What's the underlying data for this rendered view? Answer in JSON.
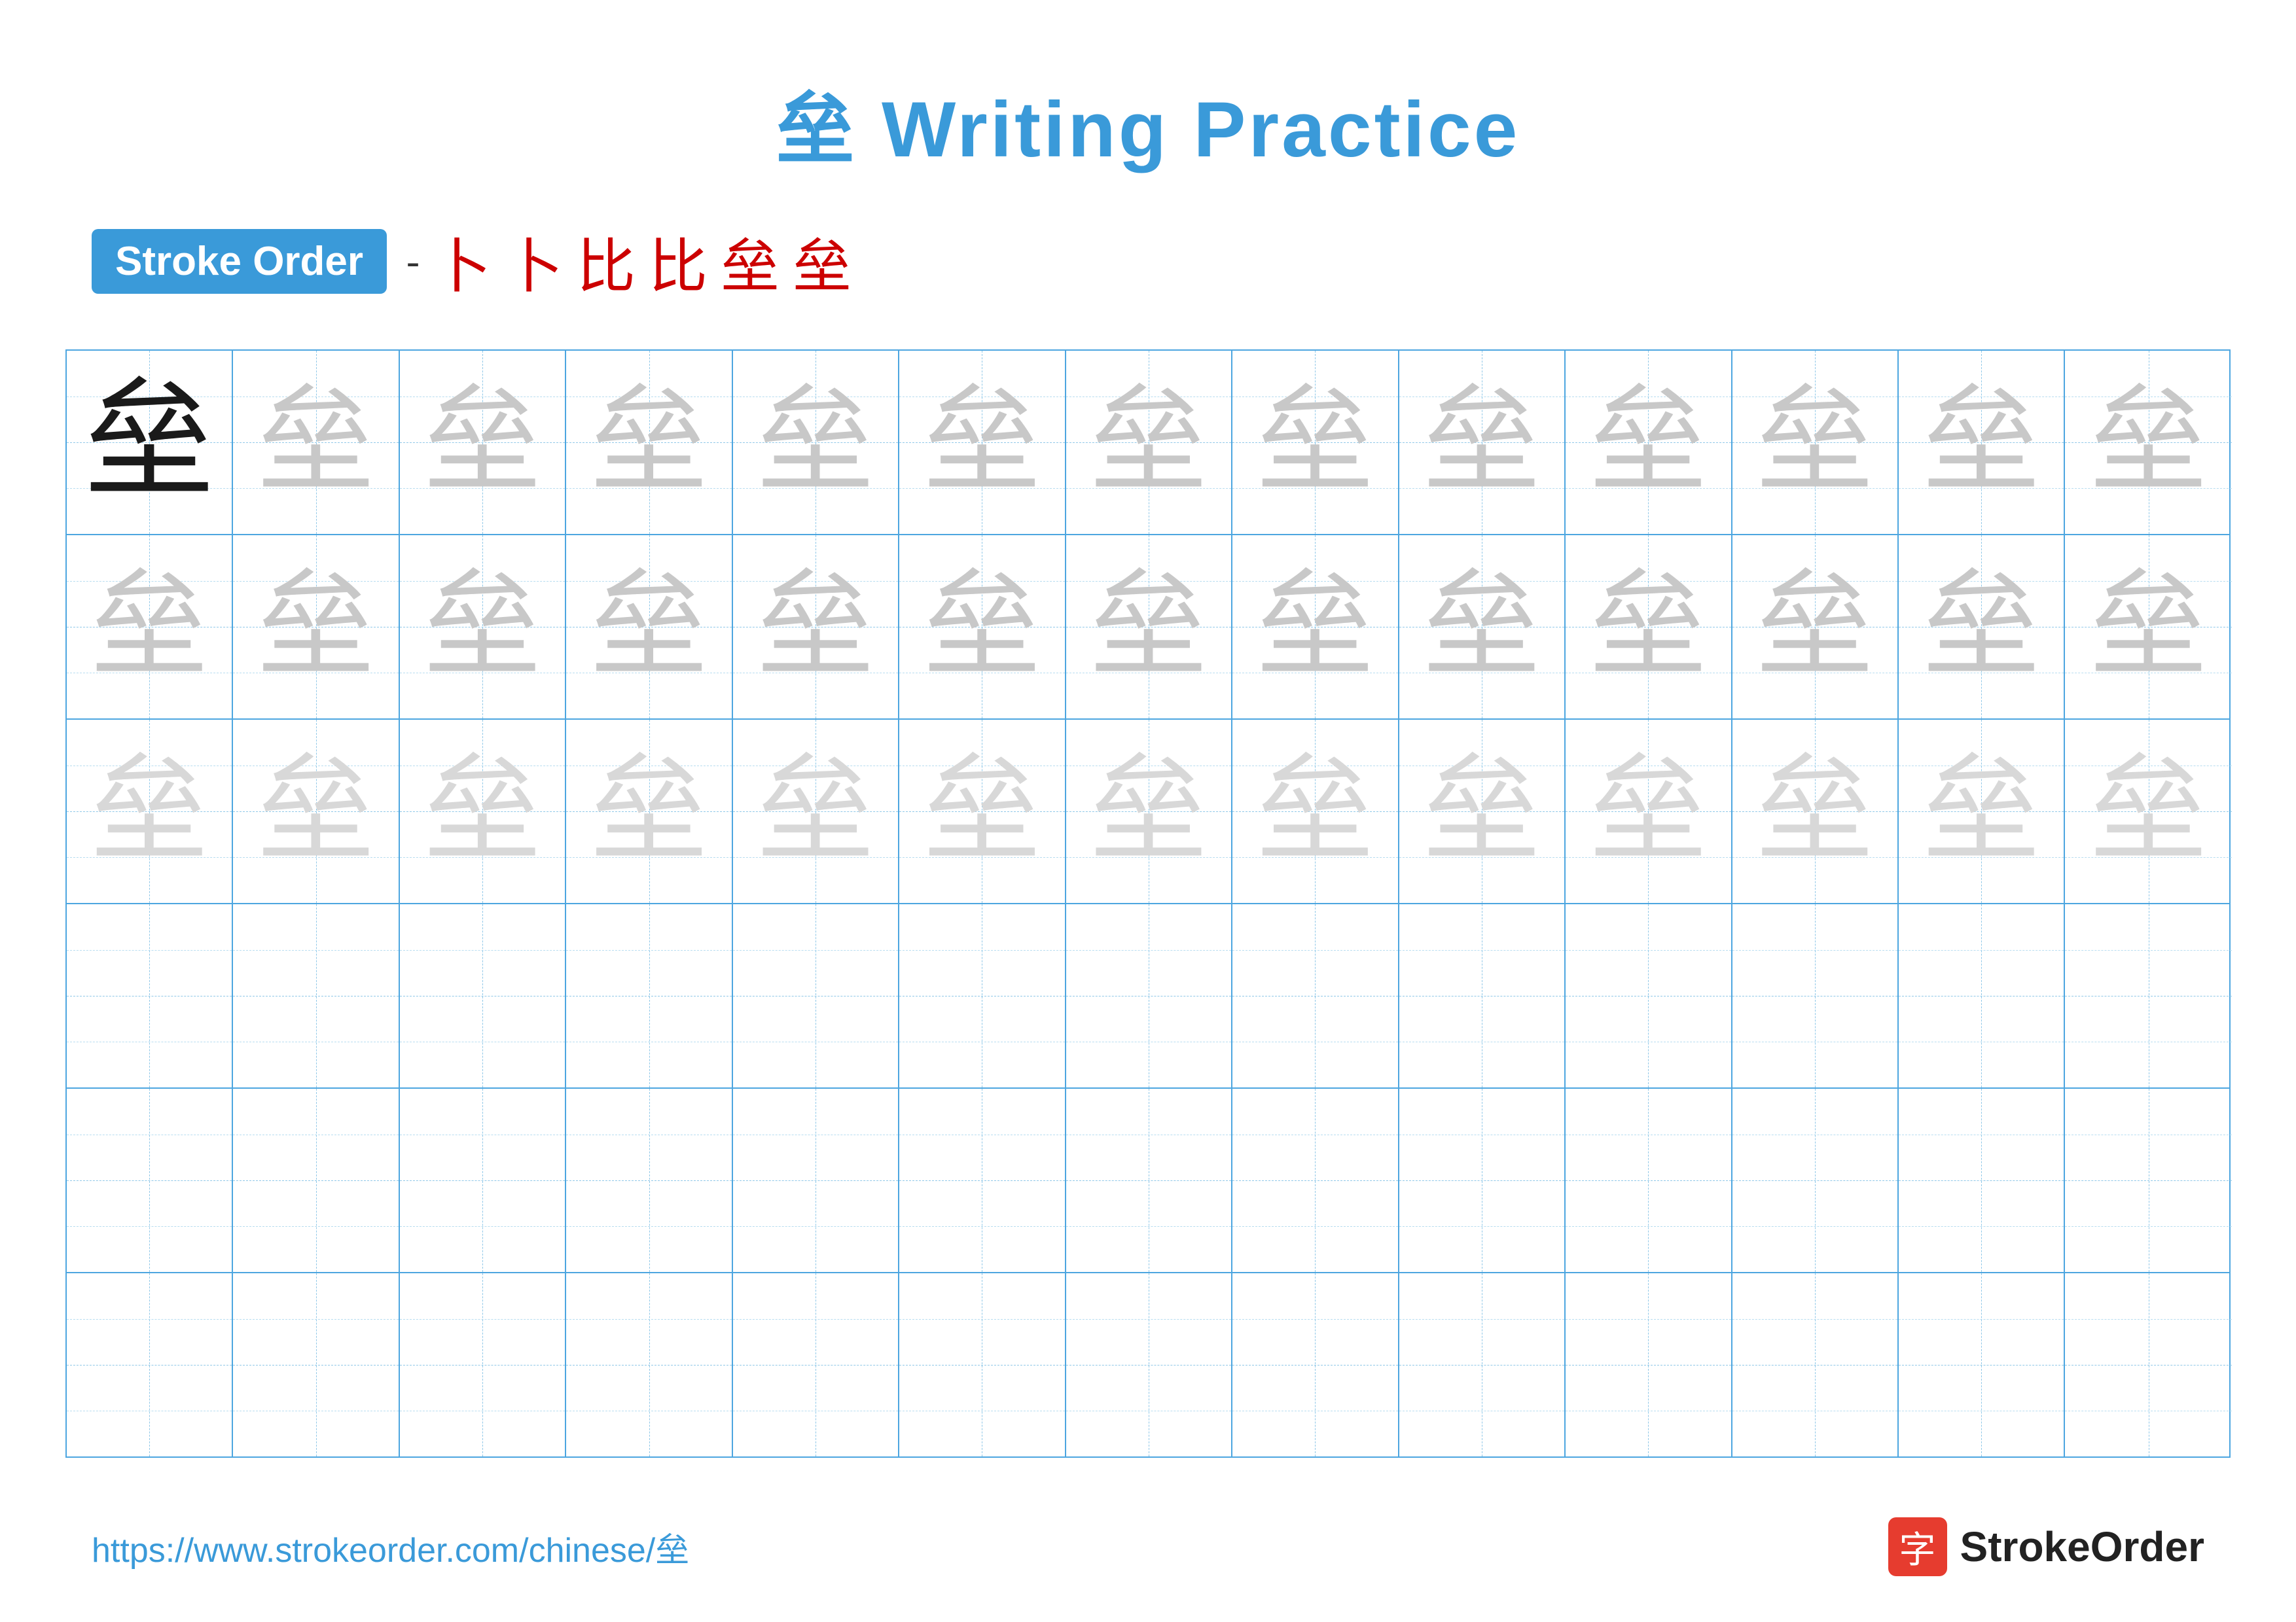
{
  "title": "垒 Writing Practice",
  "stroke_order": {
    "badge_label": "Stroke Order",
    "chars": [
      "一",
      "卜",
      "卜",
      "比",
      "比",
      "垒",
      "垒"
    ]
  },
  "grid": {
    "rows": 6,
    "cols": 13,
    "char": "垒",
    "row_types": [
      "dark+faded",
      "faded",
      "faded",
      "empty",
      "empty",
      "empty"
    ]
  },
  "footer": {
    "url": "https://www.strokeorder.com/chinese/垒",
    "logo_char": "字",
    "logo_label": "StrokeOrder"
  }
}
